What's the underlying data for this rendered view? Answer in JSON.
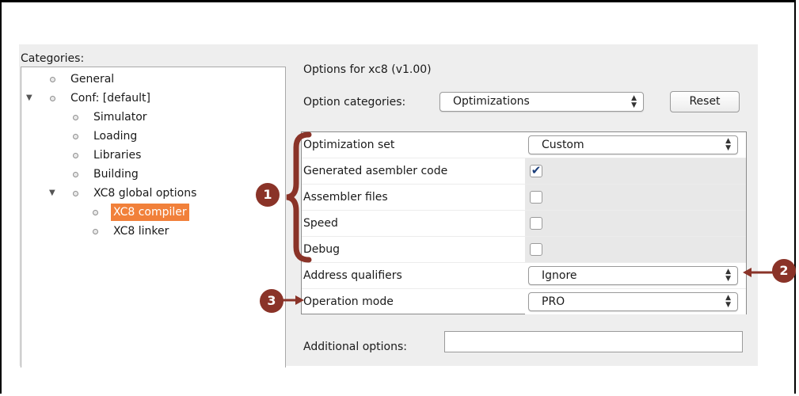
{
  "categories": {
    "title": "Categories:",
    "items": [
      {
        "label": "General",
        "level": 0,
        "arrow": ""
      },
      {
        "label": "Conf: [default]",
        "level": 0,
        "arrow": "▼"
      },
      {
        "label": "Simulator",
        "level": 1,
        "arrow": ""
      },
      {
        "label": "Loading",
        "level": 1,
        "arrow": ""
      },
      {
        "label": "Libraries",
        "level": 1,
        "arrow": ""
      },
      {
        "label": "Building",
        "level": 1,
        "arrow": ""
      },
      {
        "label": "XC8 global options",
        "level": 1,
        "arrow": "▼"
      },
      {
        "label": "XC8 compiler",
        "level": 2,
        "arrow": "",
        "selected": true
      },
      {
        "label": "XC8 linker",
        "level": 2,
        "arrow": ""
      }
    ]
  },
  "options": {
    "title": "Options for xc8 (v1.00)",
    "category_label": "Option categories:",
    "category_value": "Optimizations",
    "reset_label": "Reset",
    "rows": [
      {
        "label": "Optimization set",
        "type": "select",
        "value": "Custom"
      },
      {
        "label": "Generated asembler code",
        "type": "checkbox",
        "checked": true
      },
      {
        "label": "Assembler files",
        "type": "checkbox",
        "checked": false
      },
      {
        "label": "Speed",
        "type": "checkbox",
        "checked": false
      },
      {
        "label": "Debug",
        "type": "checkbox",
        "checked": false
      },
      {
        "label": "Address qualifiers",
        "type": "select",
        "value": "Ignore"
      },
      {
        "label": "Operation mode",
        "type": "select",
        "value": "PRO"
      }
    ],
    "additional_label": "Additional options:",
    "additional_value": ""
  },
  "callouts": [
    "1",
    "2",
    "3"
  ],
  "colors": {
    "selection": "#f1803a",
    "callout": "#8a3328",
    "checkmark": "#1b3e7a"
  }
}
